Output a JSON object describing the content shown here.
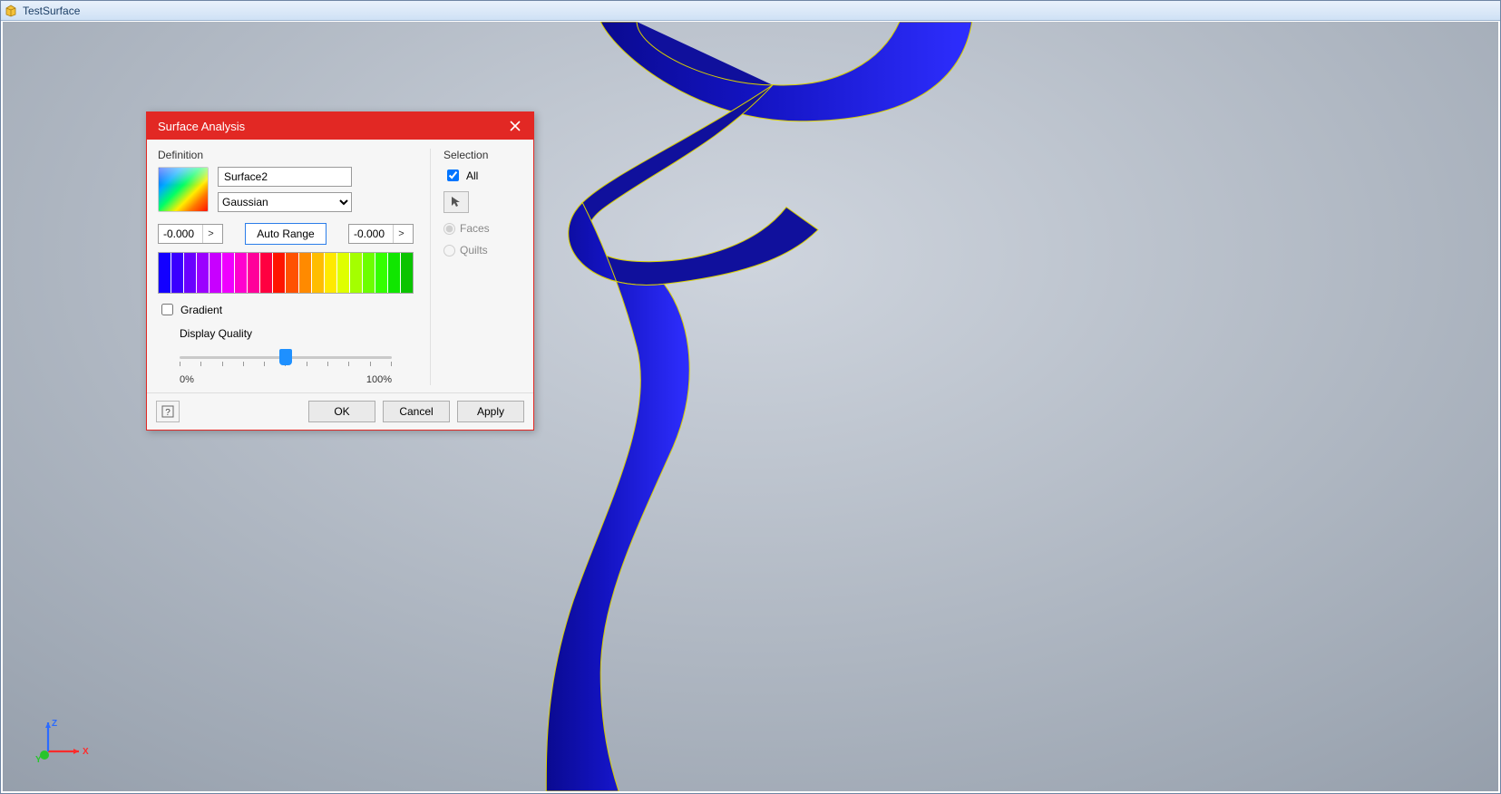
{
  "app": {
    "title": "TestSurface"
  },
  "dialog": {
    "title": "Surface Analysis",
    "definition": {
      "heading": "Definition",
      "name_value": "Surface2",
      "type_selected": "Gaussian",
      "range_min": "-0.000",
      "range_max": "-0.000",
      "auto_range_label": "Auto Range",
      "gradient_label": "Gradient",
      "gradient_checked": false,
      "quality_label": "Display Quality",
      "quality_min": "0%",
      "quality_max": "100%",
      "quality_value_pct": 50
    },
    "selection": {
      "heading": "Selection",
      "all_label": "All",
      "all_checked": true,
      "option_faces": "Faces",
      "option_quilts": "Quilts",
      "picked_option": "Faces"
    },
    "buttons": {
      "ok": "OK",
      "cancel": "Cancel",
      "apply": "Apply",
      "help_tooltip": "Help"
    },
    "rainbow_colors": [
      "#1300ff",
      "#3a00ff",
      "#6a00ff",
      "#9b00ff",
      "#c800ff",
      "#ef00ff",
      "#ff00cf",
      "#ff009a",
      "#ff0040",
      "#ff1400",
      "#ff5100",
      "#ff8a00",
      "#ffbd00",
      "#ffe900",
      "#dfff00",
      "#a4ff00",
      "#6cff00",
      "#34ff00",
      "#10e600",
      "#0bc400"
    ]
  },
  "gizmo": {
    "x": "X",
    "y": "Y",
    "z": "Z"
  }
}
